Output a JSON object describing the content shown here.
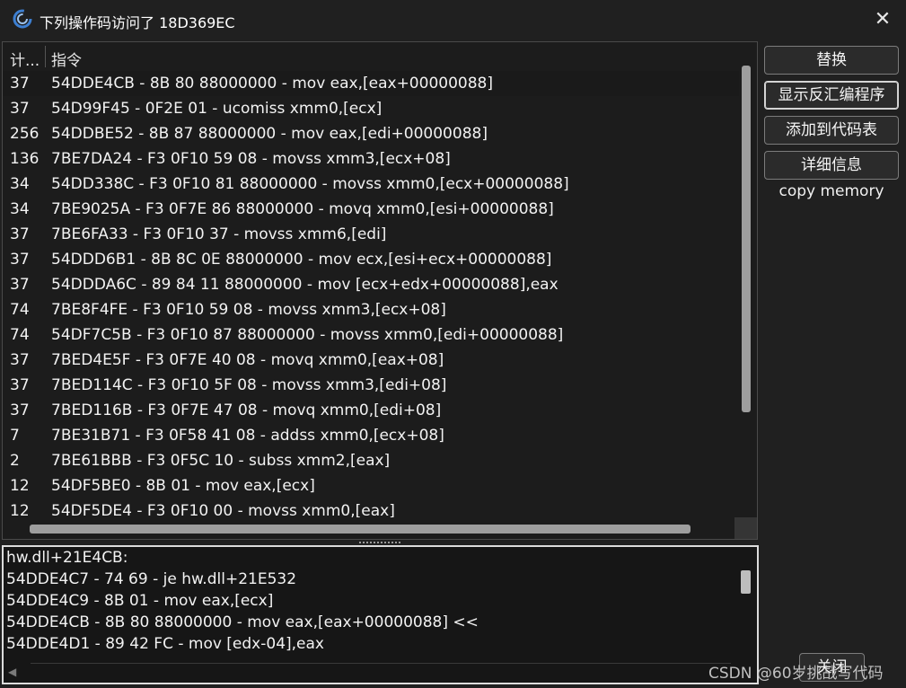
{
  "window": {
    "title": "下列操作码访问了 18D369EC",
    "close_symbol": "✕"
  },
  "list": {
    "headers": {
      "count": "计...",
      "instruction": "指令"
    },
    "rows": [
      {
        "count": "37",
        "instruction": "54DDE4CB - 8B 80 88000000  - mov eax,[eax+00000088]"
      },
      {
        "count": "37",
        "instruction": "54D99F45 - 0F2E 01  - ucomiss xmm0,[ecx]"
      },
      {
        "count": "256",
        "instruction": "54DDBE52 - 8B 87 88000000  - mov eax,[edi+00000088]"
      },
      {
        "count": "136",
        "instruction": "7BE7DA24 - F3 0F10 59 08  - movss xmm3,[ecx+08]"
      },
      {
        "count": "34",
        "instruction": "54DD338C - F3 0F10 81 88000000  - movss xmm0,[ecx+00000088]"
      },
      {
        "count": "34",
        "instruction": "7BE9025A - F3 0F7E 86 88000000  - movq xmm0,[esi+00000088]"
      },
      {
        "count": "37",
        "instruction": "7BE6FA33 - F3 0F10 37  - movss xmm6,[edi]"
      },
      {
        "count": "37",
        "instruction": "54DDD6B1 - 8B 8C 0E 88000000  - mov ecx,[esi+ecx+00000088]"
      },
      {
        "count": "37",
        "instruction": "54DDDA6C - 89 84 11 88000000  - mov [ecx+edx+00000088],eax"
      },
      {
        "count": "74",
        "instruction": "7BE8F4FE - F3 0F10 59 08  - movss xmm3,[ecx+08]"
      },
      {
        "count": "74",
        "instruction": "54DF7C5B - F3 0F10 87 88000000  - movss xmm0,[edi+00000088]"
      },
      {
        "count": "37",
        "instruction": "7BED4E5F - F3 0F7E 40 08  - movq xmm0,[eax+08]"
      },
      {
        "count": "37",
        "instruction": "7BED114C - F3 0F10 5F 08  - movss xmm3,[edi+08]"
      },
      {
        "count": "37",
        "instruction": "7BED116B - F3 0F7E 47 08  - movq xmm0,[edi+08]"
      },
      {
        "count": "7",
        "instruction": "7BE31B71 - F3 0F58 41 08  - addss xmm0,[ecx+08]"
      },
      {
        "count": "2",
        "instruction": "7BE61BBB - F3 0F5C 10  - subss xmm2,[eax]"
      },
      {
        "count": "12",
        "instruction": "54DF5BE0 - 8B 01  - mov eax,[ecx]"
      },
      {
        "count": "12",
        "instruction": "54DF5DE4 - F3 0F10 00  - movss xmm0,[eax]"
      }
    ]
  },
  "disassembly": {
    "lines": [
      "hw.dll+21E4CB:",
      "54DDE4C7 - 74 69 - je hw.dll+21E532",
      "54DDE4C9 - 8B 01  - mov eax,[ecx]",
      "54DDE4CB - 8B 80 88000000  - mov eax,[eax+00000088] <<",
      "54DDE4D1 - 89 42 FC  - mov [edx-04],eax"
    ],
    "scroll_left_arrow": "◀"
  },
  "buttons": {
    "replace": "替换",
    "show_disassembler": "显示反汇编程序",
    "add_to_codelist": "添加到代码表",
    "more_info": "详细信息",
    "close": "关闭"
  },
  "side_label": "copy memory",
  "watermark": "CSDN @60岁挑战写代码"
}
